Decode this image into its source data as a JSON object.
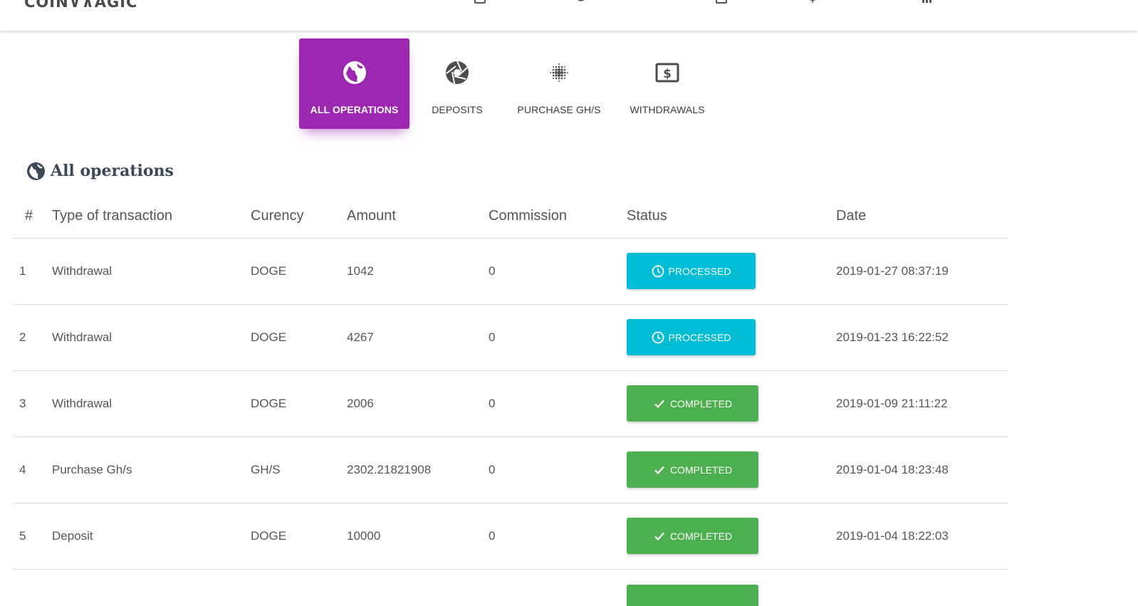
{
  "header": {
    "logo_text": "COIN∨∧AGIC",
    "nav_icons": [
      "calendar-icon",
      "refresh-icon",
      "wallet-icon",
      "globe-icon",
      "chart-icon"
    ]
  },
  "tabs": [
    {
      "label": "ALL OPERATIONS",
      "icon": "globe-icon",
      "active": true
    },
    {
      "label": "DEPOSITS",
      "icon": "aperture-icon",
      "active": false
    },
    {
      "label": "PURCHASE GH/S",
      "icon": "dots-grid-icon",
      "active": false
    },
    {
      "label": "WITHDRAWALS",
      "icon": "money-icon",
      "active": false
    }
  ],
  "section": {
    "title": "All operations",
    "icon": "globe-icon"
  },
  "table": {
    "headers": {
      "num": "#",
      "type": "Type of transaction",
      "currency": "Curency",
      "amount": "Amount",
      "commission": "Commission",
      "status": "Status",
      "date": "Date"
    },
    "rows": [
      {
        "num": "1",
        "type": "Withdrawal",
        "currency": "DOGE",
        "amount": "1042",
        "commission": "0",
        "status": "PROCESSED",
        "date": "2019-01-27 08:37:19"
      },
      {
        "num": "2",
        "type": "Withdrawal",
        "currency": "DOGE",
        "amount": "4267",
        "commission": "0",
        "status": "PROCESSED",
        "date": "2019-01-23 16:22:52"
      },
      {
        "num": "3",
        "type": "Withdrawal",
        "currency": "DOGE",
        "amount": "2006",
        "commission": "0",
        "status": "COMPLETED",
        "date": "2019-01-09 21:11:22"
      },
      {
        "num": "4",
        "type": "Purchase Gh/s",
        "currency": "GH/S",
        "amount": "2302.21821908",
        "commission": "0",
        "status": "COMPLETED",
        "date": "2019-01-04 18:23:48"
      },
      {
        "num": "5",
        "type": "Deposit",
        "currency": "DOGE",
        "amount": "10000",
        "commission": "0",
        "status": "COMPLETED",
        "date": "2019-01-04 18:22:03"
      }
    ]
  },
  "colors": {
    "accent": "#9c27b0",
    "processed": "#00bcd4",
    "completed": "#4caf50"
  }
}
